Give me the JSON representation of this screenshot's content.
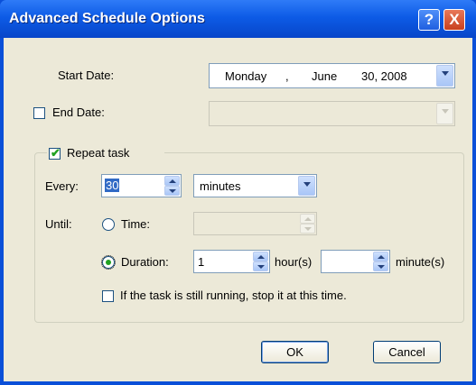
{
  "window": {
    "title": "Advanced Schedule Options",
    "help_glyph": "?",
    "close_glyph": "X"
  },
  "start_date": {
    "label": "Start Date:",
    "weekday": "Monday",
    "sep": ",",
    "month": "June",
    "day_year": "30, 2008"
  },
  "end_date": {
    "label": "End Date:",
    "checked": false,
    "value": ""
  },
  "repeat": {
    "label": "Repeat task",
    "checked": true,
    "every_label": "Every:",
    "every_value": "30",
    "unit_value": "minutes",
    "until_label": "Until:",
    "time_label": "Time:",
    "time_value": "",
    "duration_label": "Duration:",
    "hours_value": "1",
    "hours_label": "hour(s)",
    "minutes_value": "",
    "minutes_label": "minute(s)",
    "stop_label": "If the task is still running, stop it at this time.",
    "stop_checked": false
  },
  "buttons": {
    "ok": "OK",
    "cancel": "Cancel"
  },
  "colors": {
    "titlebar": "#0d5be6",
    "dialog_bg": "#ece9d8",
    "check_green": "#21a121",
    "selection": "#316ac5"
  }
}
